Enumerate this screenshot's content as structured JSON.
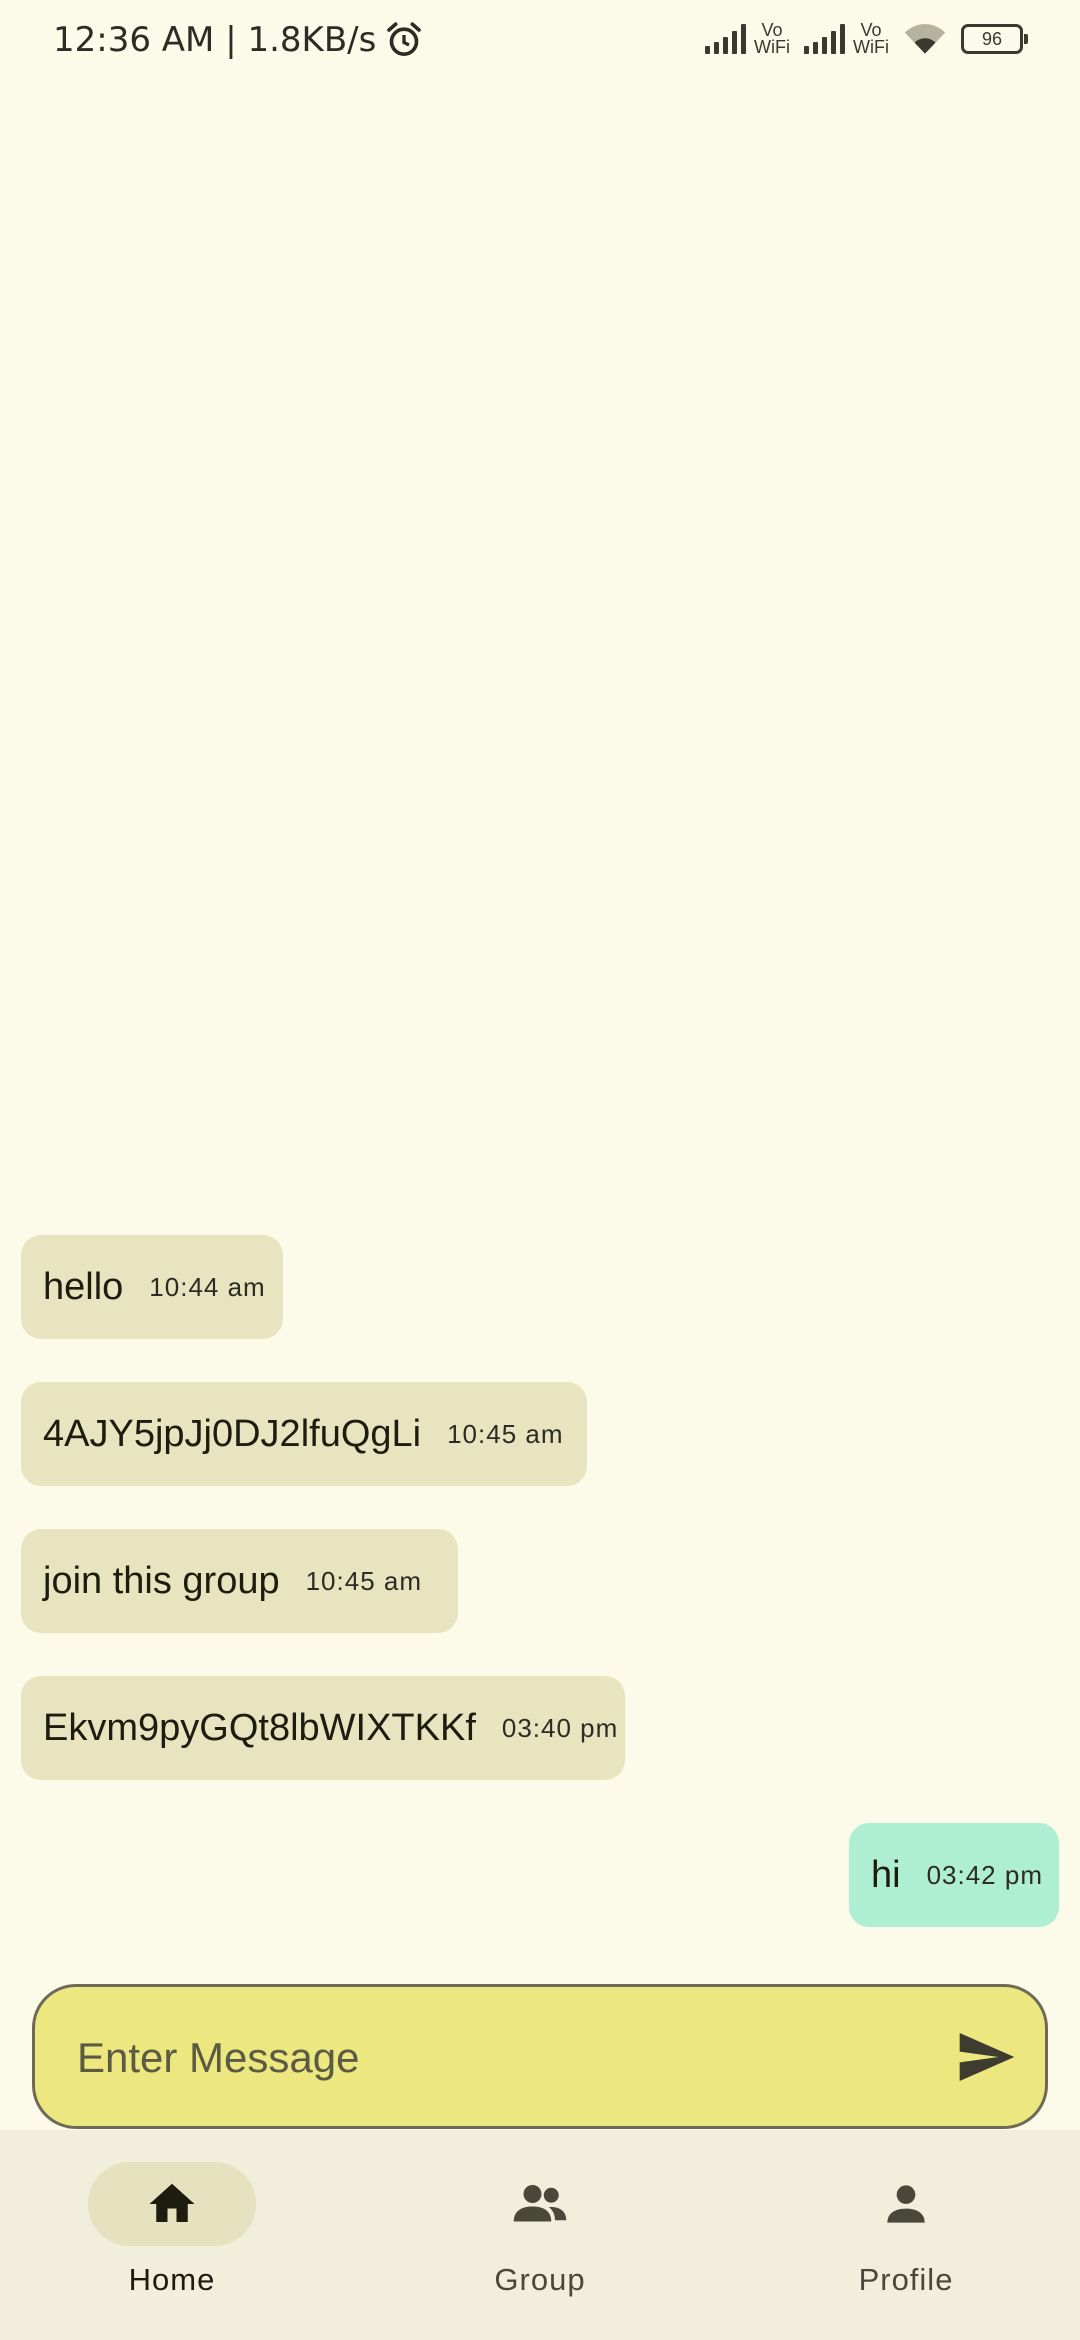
{
  "status_bar": {
    "time_speed": "12:36 AM | 1.8KB/s",
    "sim1_label_top": "Vo",
    "sim1_label_bottom": "WiFi",
    "sim2_label_top": "Vo",
    "sim2_label_bottom": "WiFi",
    "battery": "96"
  },
  "messages": [
    {
      "text": "hello",
      "time": "10:44 am",
      "direction": "incoming"
    },
    {
      "text": "4AJY5jpJj0DJ2lfuQgLi",
      "time": "10:45 am",
      "direction": "incoming"
    },
    {
      "text": "join this group",
      "time": "10:45 am",
      "direction": "incoming"
    },
    {
      "text": "Ekvm9pyGQt8lbWIXTKKf",
      "time": "03:40 pm",
      "direction": "incoming"
    },
    {
      "text": "hi",
      "time": "03:42 pm",
      "direction": "outgoing"
    }
  ],
  "composer": {
    "placeholder": "Enter Message",
    "value": ""
  },
  "bottom_nav": {
    "items": [
      {
        "label": "Home",
        "icon": "home-icon",
        "active": true
      },
      {
        "label": "Group",
        "icon": "group-icon",
        "active": false
      },
      {
        "label": "Profile",
        "icon": "person-icon",
        "active": false
      }
    ]
  },
  "colors": {
    "background": "#FCFBEA",
    "incoming_bubble": "#E8E4C0",
    "outgoing_bubble": "#AEEFD3",
    "input_fill": "#ECE77F",
    "nav_background": "#F1EEDC",
    "nav_active_pill": "#E6E1BE"
  }
}
